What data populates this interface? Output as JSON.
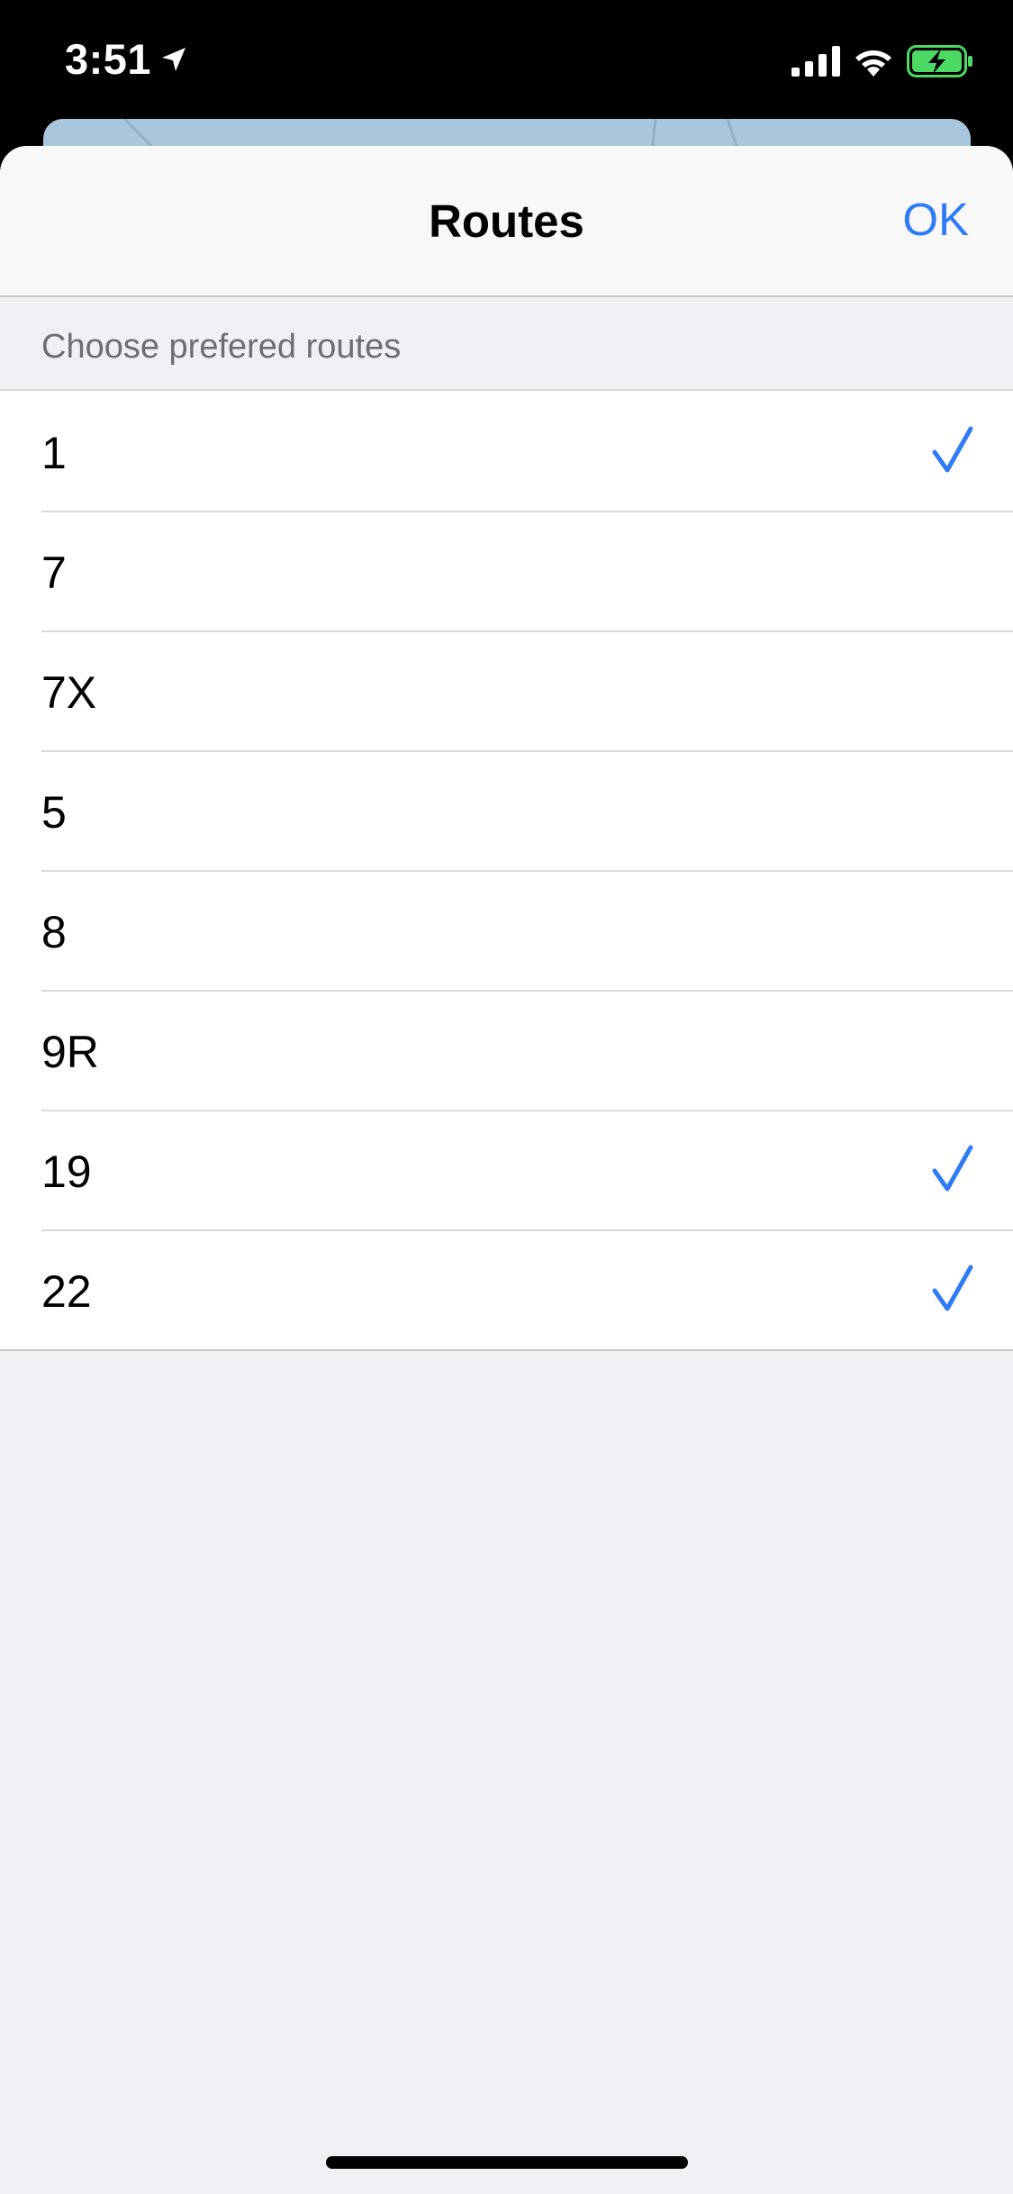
{
  "status_bar": {
    "time": "3:51",
    "icons": [
      "location-arrow-icon",
      "cellular-signal-icon",
      "wifi-icon",
      "battery-charging-icon"
    ]
  },
  "nav": {
    "title": "Routes",
    "ok_label": "OK"
  },
  "section": {
    "header": "Choose prefered routes"
  },
  "routes": [
    {
      "label": "1",
      "selected": true
    },
    {
      "label": "7",
      "selected": false
    },
    {
      "label": "7X",
      "selected": false
    },
    {
      "label": "5",
      "selected": false
    },
    {
      "label": "8",
      "selected": false
    },
    {
      "label": "9R",
      "selected": false
    },
    {
      "label": "19",
      "selected": true
    },
    {
      "label": "22",
      "selected": true
    }
  ],
  "colors": {
    "accent": "#2f7bf5",
    "sheet_background": "#efeff4",
    "row_background": "#ffffff",
    "battery_fill": "#4cd964"
  }
}
